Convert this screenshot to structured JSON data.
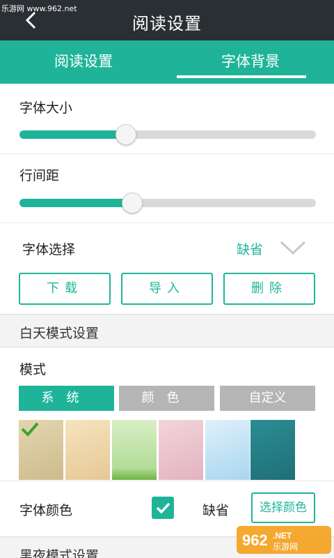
{
  "watermark_top": "乐游网 www.962.net",
  "header": {
    "title": "阅读设置"
  },
  "tabs": [
    {
      "label": "阅读设置",
      "active": false
    },
    {
      "label": "字体背景",
      "active": true
    }
  ],
  "font_size": {
    "label": "字体大小",
    "level": 0.36
  },
  "line_spacing": {
    "label": "行间距",
    "level": 0.38
  },
  "font_select": {
    "label": "字体选择",
    "value": "缺省"
  },
  "font_buttons": [
    "下载",
    "导入",
    "删除"
  ],
  "day_mode": {
    "header": "白天模式设置",
    "mode_label": "模式",
    "modes": [
      {
        "label": "系统",
        "active": true
      },
      {
        "label": "颜色",
        "active": false
      },
      {
        "label": "自定义",
        "active": false
      }
    ],
    "backgrounds": [
      {
        "name": "parchment",
        "selected": true,
        "color": "#d9c9a0"
      },
      {
        "name": "old-paper",
        "selected": false,
        "color": "#f0d9b0"
      },
      {
        "name": "green-paper",
        "selected": false,
        "color": "#bfe0a8"
      },
      {
        "name": "pink-paper",
        "selected": false,
        "color": "#ecc6cf"
      },
      {
        "name": "sky-blue",
        "selected": false,
        "color": "#bfe0f2"
      },
      {
        "name": "teal",
        "selected": false,
        "color": "#237f86"
      }
    ],
    "font_color_label": "字体颜色",
    "font_color_default_checked": true,
    "font_color_default": "缺省",
    "choose_color_button": "选择颜色"
  },
  "night_mode": {
    "header": "黑夜模式设置"
  },
  "watermark_logo": "962.NET 乐游网",
  "colors": {
    "accent": "#1fb49a",
    "appbar": "#2a2f33",
    "inactive": "#b5b5b5"
  }
}
